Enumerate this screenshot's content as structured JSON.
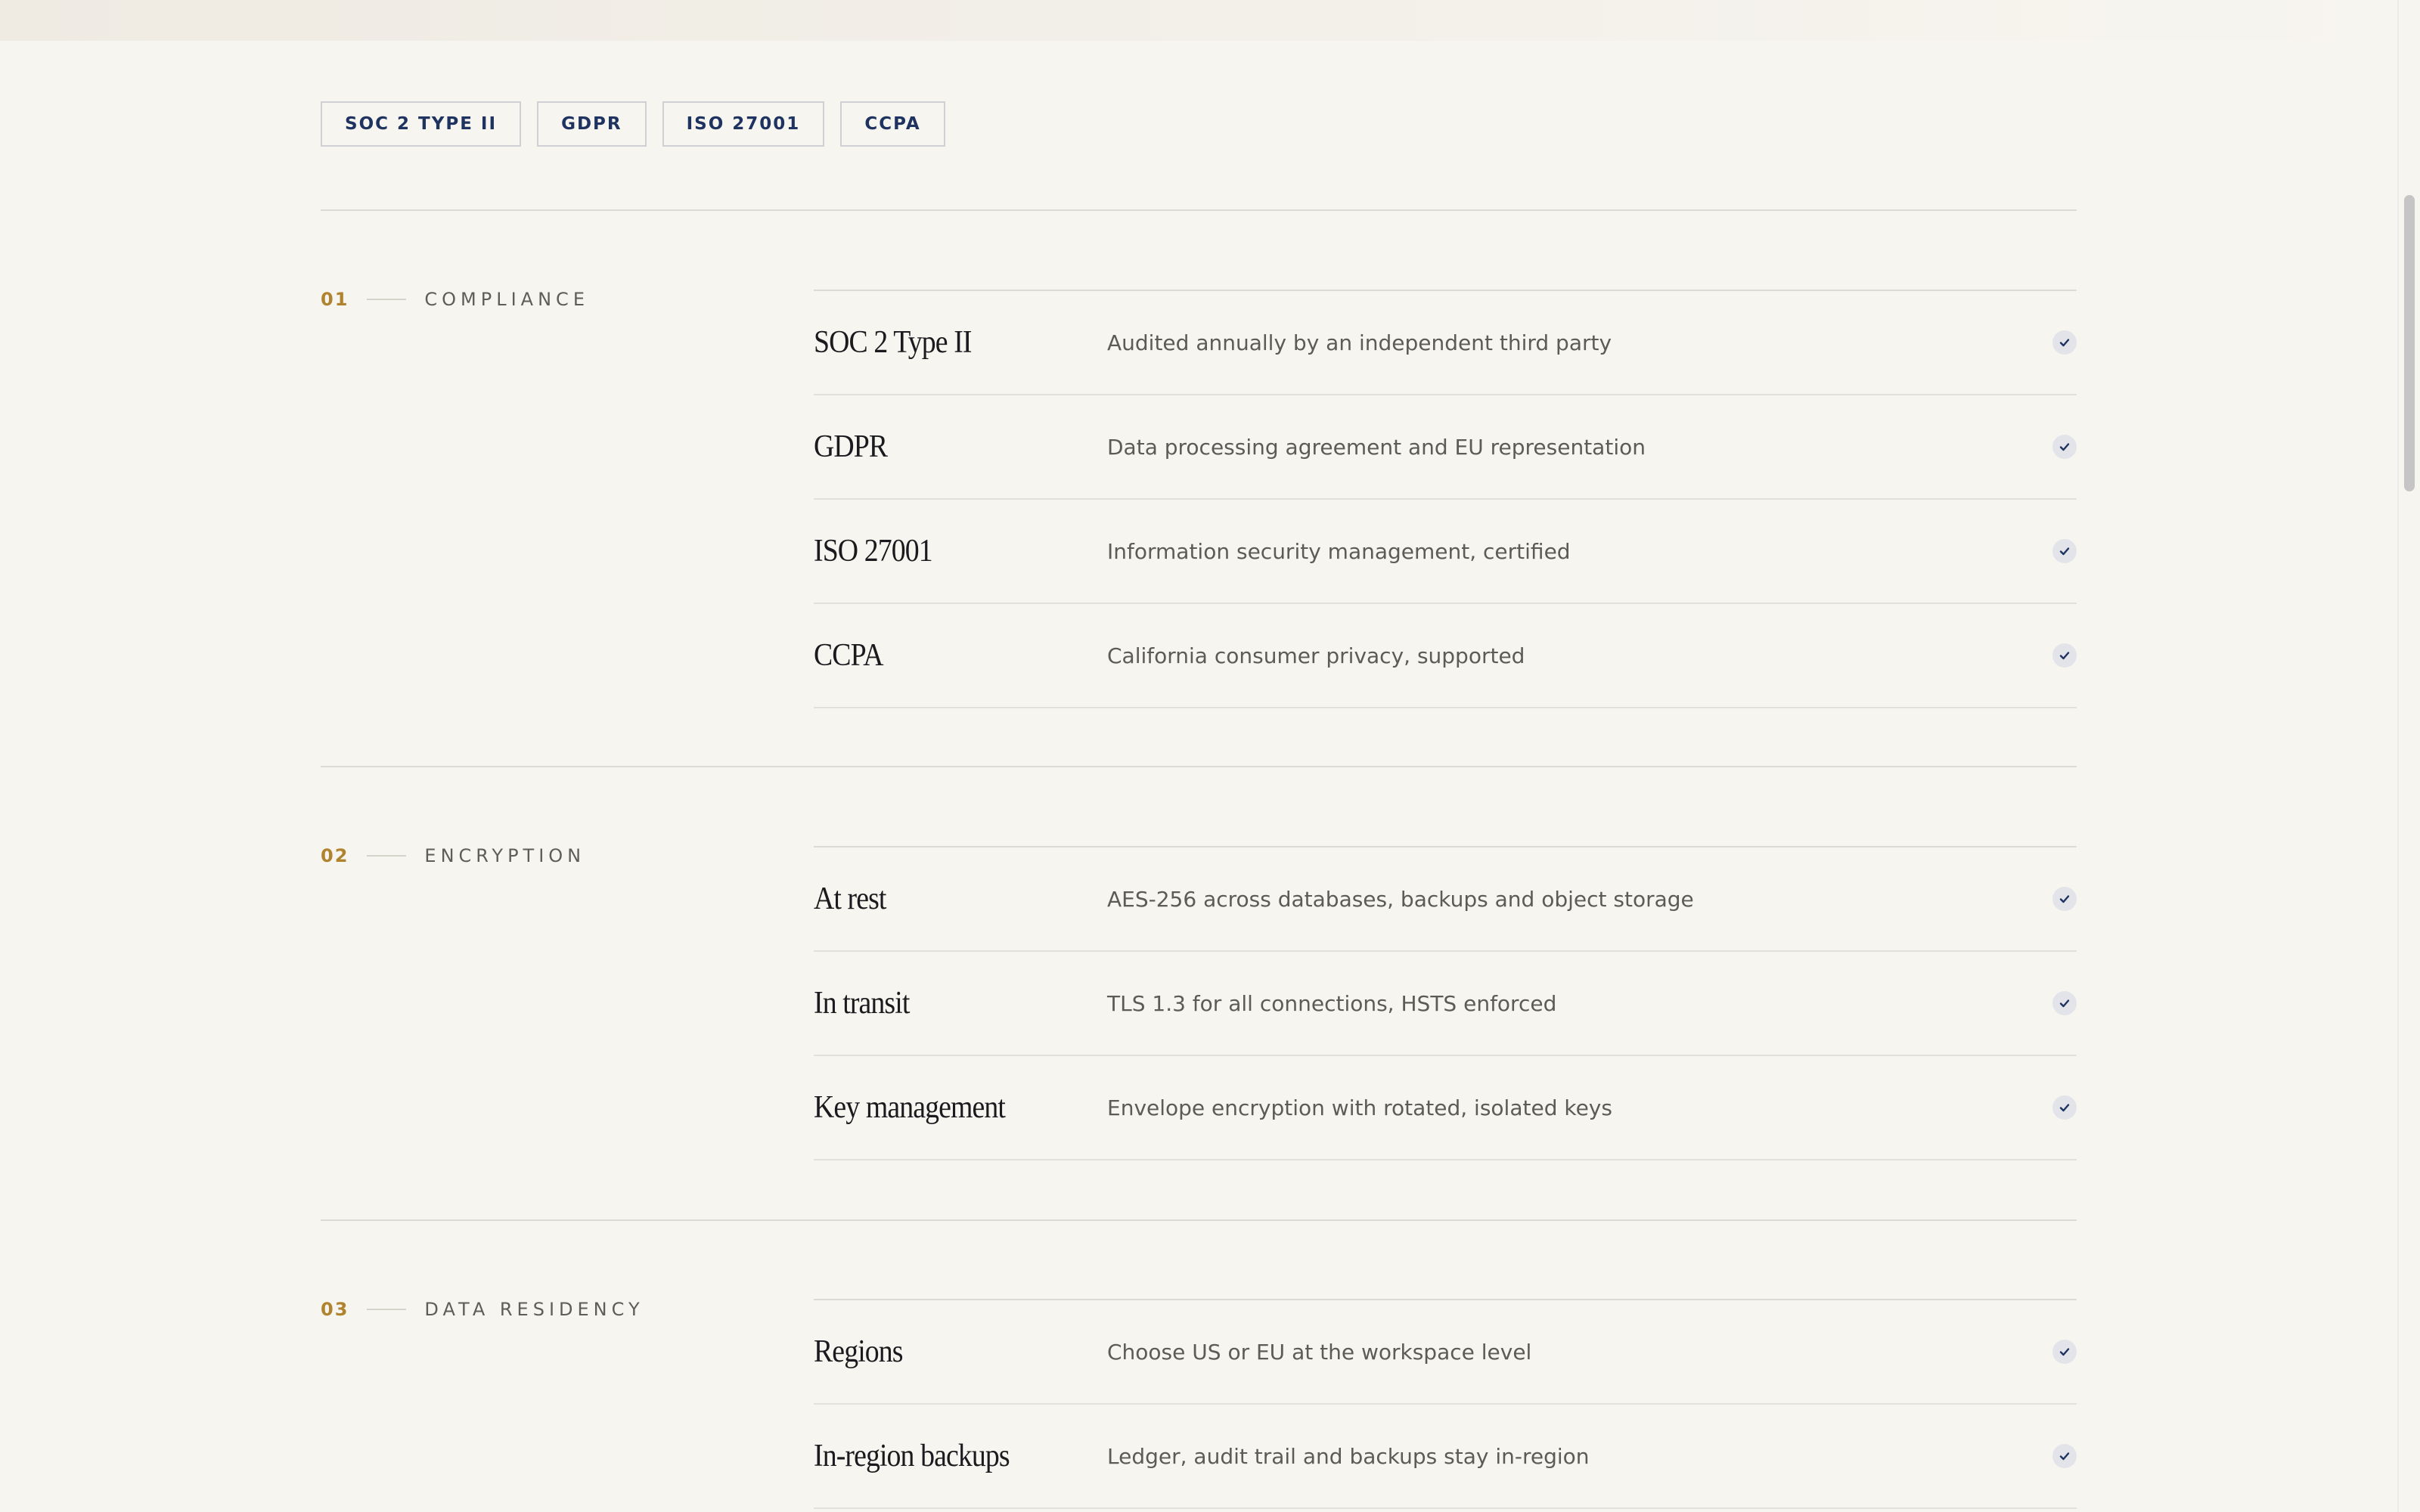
{
  "badges": [
    "SOC 2 TYPE II",
    "GDPR",
    "ISO 27001",
    "CCPA"
  ],
  "sections": [
    {
      "number": "01",
      "title": "COMPLIANCE",
      "items": [
        {
          "name": "SOC 2 Type II",
          "desc": "Audited annually by an independent third party"
        },
        {
          "name": "GDPR",
          "desc": "Data processing agreement and EU representation"
        },
        {
          "name": "ISO 27001",
          "desc": "Information security management, certified"
        },
        {
          "name": "CCPA",
          "desc": "California consumer privacy, supported"
        }
      ]
    },
    {
      "number": "02",
      "title": "ENCRYPTION",
      "items": [
        {
          "name": "At rest",
          "desc": "AES-256 across databases, backups and object storage"
        },
        {
          "name": "In transit",
          "desc": "TLS 1.3 for all connections, HSTS enforced"
        },
        {
          "name": "Key management",
          "desc": "Envelope encryption with rotated, isolated keys"
        }
      ]
    },
    {
      "number": "03",
      "title": "DATA RESIDENCY",
      "items": [
        {
          "name": "Regions",
          "desc": "Choose US or EU at the workspace level"
        },
        {
          "name": "In-region backups",
          "desc": "Ledger, audit trail and backups stay in-region"
        }
      ]
    }
  ],
  "icons": {
    "check": "check-icon"
  },
  "colors": {
    "accent": "#b0832e",
    "badge_text": "#1f3360",
    "background": "#f7f5ef"
  }
}
